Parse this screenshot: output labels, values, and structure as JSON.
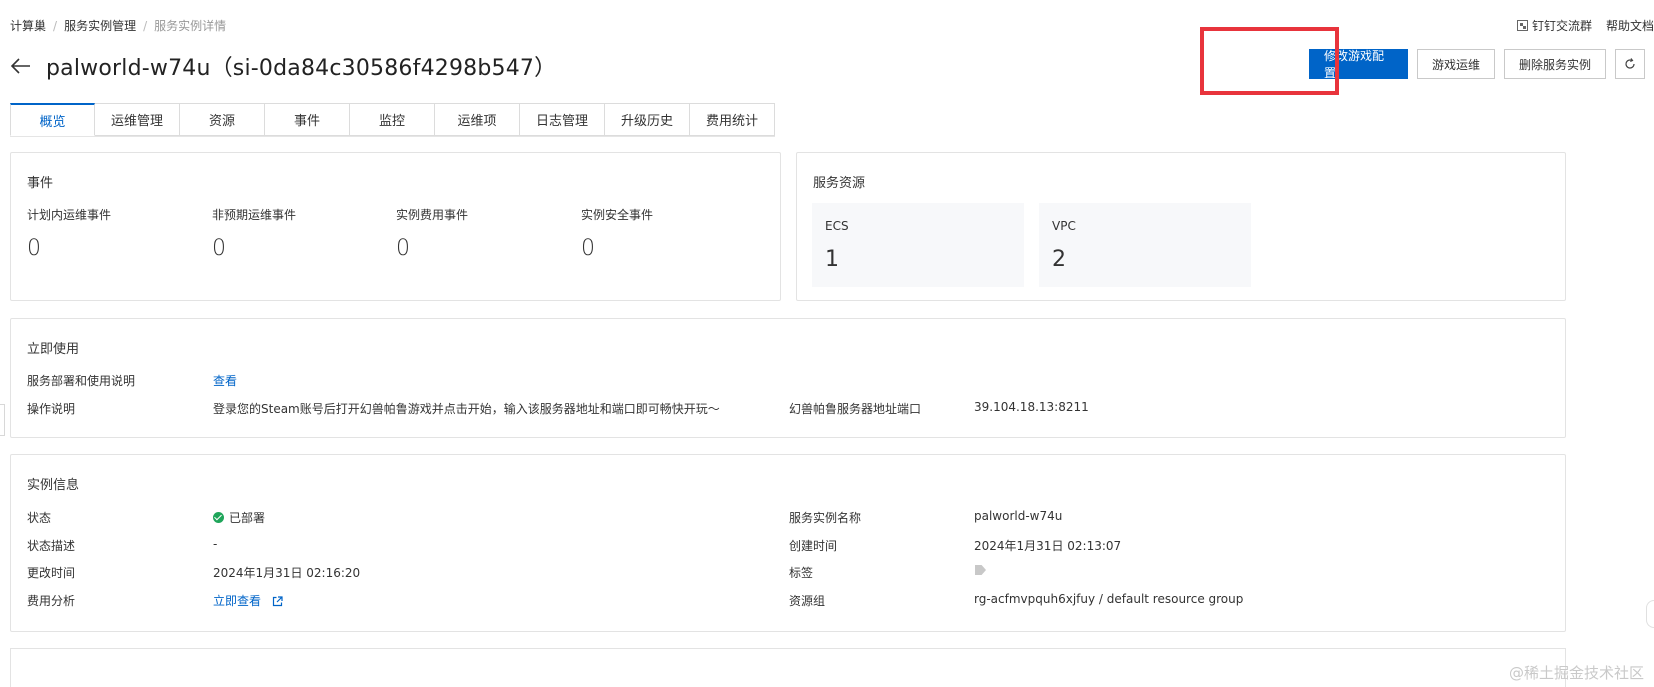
{
  "breadcrumb": {
    "items": [
      "计算巢",
      "服务实例管理",
      "服务实例详情"
    ]
  },
  "top_links": {
    "dingtalk": "钉钉交流群",
    "help": "帮助文档"
  },
  "header": {
    "title": "palworld-w74u（si-0da84c30586f4298b547）"
  },
  "actions": {
    "modify_config": "修改游戏配置",
    "game_ops": "游戏运维",
    "delete_instance": "删除服务实例"
  },
  "tabs": [
    "概览",
    "运维管理",
    "资源",
    "事件",
    "监控",
    "运维项",
    "日志管理",
    "升级历史",
    "费用统计"
  ],
  "events_card": {
    "title": "事件",
    "items": [
      {
        "label": "计划内运维事件",
        "value": "0"
      },
      {
        "label": "非预期运维事件",
        "value": "0"
      },
      {
        "label": "实例费用事件",
        "value": "0"
      },
      {
        "label": "实例安全事件",
        "value": "0"
      }
    ]
  },
  "resources_card": {
    "title": "服务资源",
    "items": [
      {
        "label": "ECS",
        "value": "1"
      },
      {
        "label": "VPC",
        "value": "2"
      }
    ]
  },
  "usage_card": {
    "title": "立即使用",
    "deploy_label": "服务部署和使用说明",
    "deploy_link": "查看",
    "guide_label": "操作说明",
    "guide_value": "登录您的Steam账号后打开幻兽帕鲁游戏并点击开始，输入该服务器地址和端口即可畅快开玩～",
    "server_label": "幻兽帕鲁服务器地址端口",
    "server_value": "39.104.18.13:8211"
  },
  "instance_card": {
    "title": "实例信息",
    "status_label": "状态",
    "status_value": "已部署",
    "status_desc_label": "状态描述",
    "status_desc_value": "-",
    "updated_label": "更改时间",
    "updated_value": "2024年1月31日 02:16:20",
    "cost_label": "费用分析",
    "cost_link": "立即查看",
    "name_label": "服务实例名称",
    "name_value": "palworld-w74u",
    "created_label": "创建时间",
    "created_value": "2024年1月31日 02:13:07",
    "tags_label": "标签",
    "rg_label": "资源组",
    "rg_value": "rg-acfmvpquh6xjfuy / default resource group"
  },
  "watermark": "@稀土掘金技术社区",
  "colors": {
    "primary": "#0064c8",
    "highlight": "#e8343c",
    "success": "#1fa55a"
  }
}
